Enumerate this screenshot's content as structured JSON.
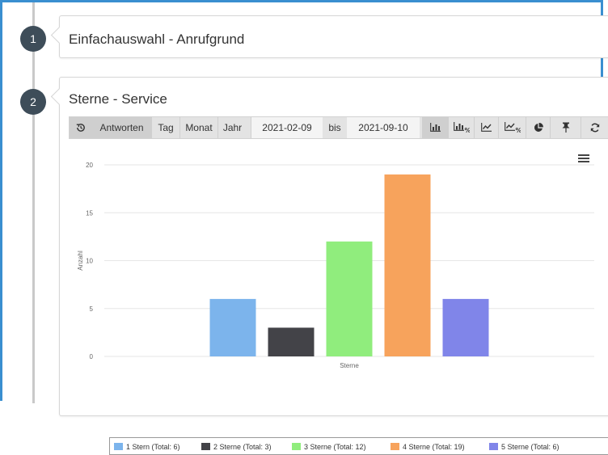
{
  "steps": [
    {
      "number": "1",
      "title": "Einfachauswahl - Anrufgrund"
    },
    {
      "number": "2",
      "title": "Sterne - Service"
    }
  ],
  "toolbar": {
    "history_icon": "history-icon",
    "answers": "Antworten",
    "day": "Tag",
    "month": "Monat",
    "year": "Jahr",
    "date_from": "2021-02-09",
    "until": "bis",
    "date_to": "2021-09-10",
    "icons": [
      "bar-chart-icon",
      "bar-chart-percent-icon",
      "line-chart-icon",
      "line-chart-percent-icon",
      "pie-chart-icon",
      "pin-icon",
      "refresh-icon"
    ]
  },
  "chart_menu_icon": "hamburger-menu-icon",
  "chart_data": {
    "type": "bar",
    "xlabel": "Sterne",
    "ylabel": "Anzahl",
    "ylim": [
      0,
      20
    ],
    "yticks": [
      0,
      5,
      10,
      15,
      20
    ],
    "grid": true,
    "legend_position": "bottom",
    "series": [
      {
        "name": "1 Stern (Total: 6)",
        "value": 6,
        "color": "#7cb4ec"
      },
      {
        "name": "2 Sterne (Total: 3)",
        "value": 3,
        "color": "#434348"
      },
      {
        "name": "3 Sterne (Total: 12)",
        "value": 12,
        "color": "#90ed7d"
      },
      {
        "name": "4 Sterne (Total: 19)",
        "value": 19,
        "color": "#f7a35c"
      },
      {
        "name": "5 Sterne (Total: 6)",
        "value": 6,
        "color": "#8085e9"
      }
    ]
  }
}
